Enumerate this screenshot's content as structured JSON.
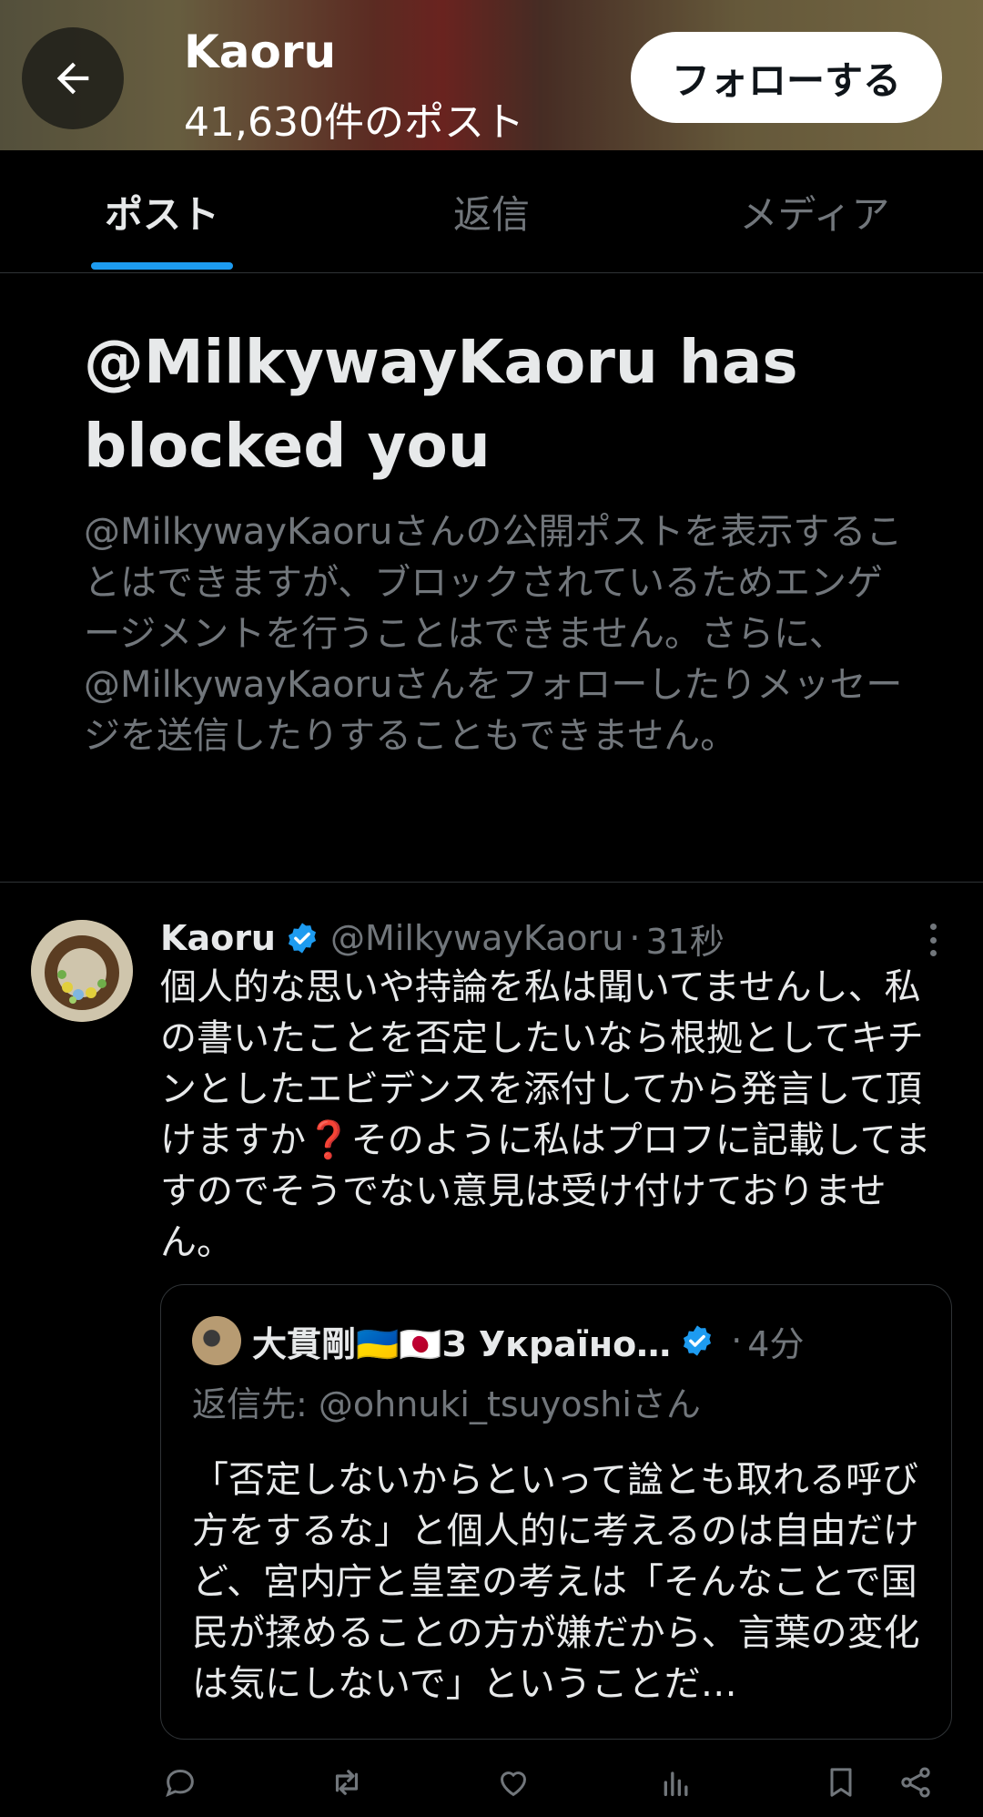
{
  "header": {
    "name": "Kaoru",
    "post_count": "41,630件のポスト",
    "follow_label": "フォローする"
  },
  "tabs": [
    {
      "label": "ポスト",
      "active": true
    },
    {
      "label": "返信",
      "active": false
    },
    {
      "label": "メディア",
      "active": false
    }
  ],
  "blocked": {
    "title": "@MilkywayKaoru has blocked you",
    "description": "@MilkywayKaoruさんの公開ポストを表示することはできますが、ブロックされているためエンゲージメントを行うことはできません。さらに、@MilkywayKaoruさんをフォローしたりメッセージを送信したりすることもできません。"
  },
  "post": {
    "author": "Kaoru",
    "handle": "@MilkywayKaoru",
    "separator": "·",
    "time": "31秒",
    "text": "個人的な思いや持論を私は聞いてませんし、私の書いたことを否定したいなら根拠としてキチンとしたエビデンスを添付してから発言して頂けますか❓そのように私はプロフに記載してますのでそうでない意見は受け付けておりません。",
    "quote": {
      "author": "大貫剛🇺🇦🇯🇵З Україно…",
      "separator": "·",
      "time": "4分",
      "reply_to": "返信先: @ohnuki_tsuyoshiさん",
      "text": "「否定しないからといって諡とも取れる呼び方をするな」と個人的に考えるのは自由だけど、宮内庁と皇室の考えは「そんなことで国民が揉めることの方が嫌だから、言葉の変化は気にしないで」ということだ…"
    }
  },
  "colors": {
    "accent": "#1d9bf0",
    "muted": "#71767b",
    "text": "#e7e9ea",
    "border": "#2f3336",
    "background": "#000000"
  },
  "icons": [
    "arrow-left-icon",
    "verified-badge-icon",
    "more-vertical-icon",
    "reply-icon",
    "retweet-icon",
    "like-icon",
    "views-icon",
    "bookmark-icon",
    "share-icon"
  ]
}
